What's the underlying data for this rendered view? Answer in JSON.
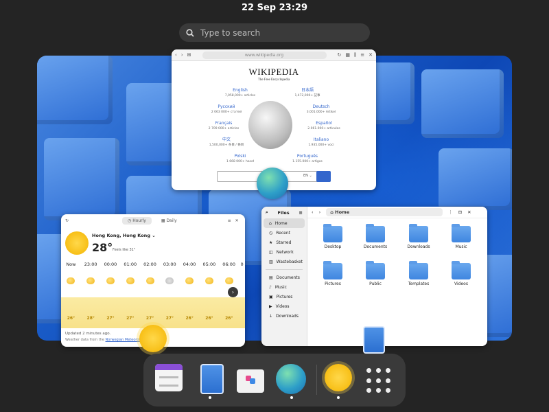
{
  "topbar": {
    "clock": "22 Sep  23:29"
  },
  "search": {
    "placeholder": "Type to search"
  },
  "browser": {
    "url": "www.wikipedia.org",
    "logo": "WIKIPEDIA",
    "tagline": "The Free Encyclopedia",
    "languages": [
      {
        "name": "English",
        "count": "7,058,000+ articles"
      },
      {
        "name": "日本語",
        "count": "1,472,000+ 記事"
      },
      {
        "name": "Русский",
        "count": "2 063 000+ статей"
      },
      {
        "name": "Deutsch",
        "count": "3.001.000+ Artikel"
      },
      {
        "name": "Français",
        "count": "2 709 000+ articles"
      },
      {
        "name": "Español",
        "count": "2.061.000+ artículos"
      },
      {
        "name": "中文",
        "count": "1,500,000+ 条目 / 條目"
      },
      {
        "name": "Italiano",
        "count": "1.935.000+ voci"
      },
      {
        "name": "Polski",
        "count": "1 668 000+ haseł"
      },
      {
        "name": "Português",
        "count": "1.155.000+ artigos"
      }
    ],
    "lang_select": "EN"
  },
  "weather": {
    "tab_hourly": "Hourly",
    "tab_daily": "Daily",
    "city": "Hong Kong, Hong Kong",
    "temp": "28°",
    "feels": "Feels like 31°",
    "hours": [
      "Now",
      "23:00",
      "00:00",
      "01:00",
      "02:00",
      "03:00",
      "04:00",
      "05:00",
      "06:00",
      "0"
    ],
    "temps": [
      "26°",
      "28°",
      "27°",
      "27°",
      "27°",
      "27°",
      "26°",
      "26°",
      "26°"
    ],
    "updated": "Updated 2 minutes ago.",
    "source_prefix": "Weather data from the ",
    "source_link": "Norwegian Meteorologic"
  },
  "files": {
    "title": "Files",
    "path": "Home",
    "sidebar": [
      "Home",
      "Recent",
      "Starred",
      "Network",
      "Wastebasket"
    ],
    "bookmarks": [
      "Documents",
      "Music",
      "Pictures",
      "Videos",
      "Downloads"
    ],
    "folders": [
      "Desktop",
      "Documents",
      "Downloads",
      "Music",
      "Pictures",
      "Public",
      "Templates",
      "Videos"
    ]
  },
  "colors": {
    "accent": "#3584e4",
    "link": "#3366cc",
    "dock": "#3a3a3a",
    "panel": "#242424"
  },
  "dock": {
    "apps": [
      "calendar-icon",
      "files-icon",
      "software-icon",
      "web-browser-icon",
      "weather-icon",
      "app-grid-icon"
    ]
  }
}
